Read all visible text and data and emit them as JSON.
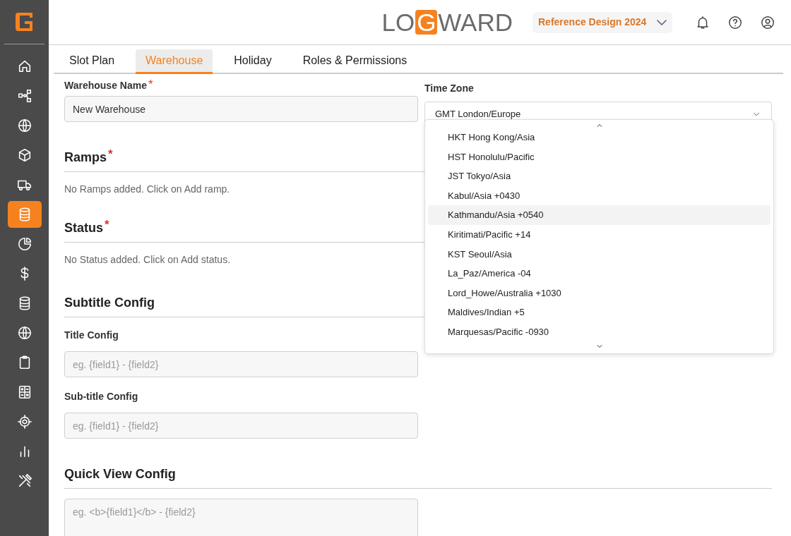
{
  "sidebar": {
    "items": [
      {
        "selected": false
      },
      {
        "selected": false
      },
      {
        "selected": false
      },
      {
        "selected": false
      },
      {
        "selected": false
      },
      {
        "selected": true
      },
      {
        "selected": false
      },
      {
        "selected": false
      },
      {
        "selected": false
      },
      {
        "selected": false
      },
      {
        "selected": false
      },
      {
        "selected": false
      },
      {
        "selected": false
      },
      {
        "selected": false
      },
      {
        "selected": false
      }
    ]
  },
  "header": {
    "logo": {
      "before": "LO",
      "mark": "G",
      "after": "WARD"
    },
    "project": "Reference Design 2024"
  },
  "tabs": [
    {
      "label": "Slot Plan",
      "selected": false
    },
    {
      "label": "Warehouse",
      "selected": true
    },
    {
      "label": "Holiday",
      "selected": false
    },
    {
      "label": "Roles & Permissions",
      "selected": false
    }
  ],
  "form": {
    "warehouse_name": {
      "label": "Warehouse Name",
      "required_mark": "*",
      "value": "New Warehouse"
    },
    "time_zone": {
      "label": "Time Zone",
      "value": "GMT London/Europe",
      "expanded": true,
      "options": [
        {
          "label": "HKT Hong Kong/Asia",
          "highlighted": false
        },
        {
          "label": "HST Honolulu/Pacific",
          "highlighted": false
        },
        {
          "label": "JST Tokyo/Asia",
          "highlighted": false
        },
        {
          "label": "Kabul/Asia +0430",
          "highlighted": false
        },
        {
          "label": "Kathmandu/Asia +0540",
          "highlighted": true
        },
        {
          "label": "Kiritimati/Pacific +14",
          "highlighted": false
        },
        {
          "label": "KST Seoul/Asia",
          "highlighted": false
        },
        {
          "label": "La_Paz/America -04",
          "highlighted": false
        },
        {
          "label": "Lord_Howe/Australia +1030",
          "highlighted": false
        },
        {
          "label": "Maldives/Indian +5",
          "highlighted": false
        },
        {
          "label": "Marquesas/Pacific -0930",
          "highlighted": false
        }
      ]
    },
    "sections": [
      {
        "title": "Ramps",
        "required_mark": "*",
        "empty_text": "No Ramps added. Click on Add ramp."
      },
      {
        "title": "Status",
        "required_mark": "*",
        "empty_text": "No Status added. Click on Add status."
      },
      {
        "title": "Subtitle Config",
        "fields": [
          {
            "label": "Title Config",
            "placeholder": "eg. {field1} - {field2}"
          },
          {
            "label": "Sub-title Config",
            "placeholder": "eg. {field1} - {field2}"
          }
        ]
      },
      {
        "title": "Quick View Config",
        "textarea": {
          "placeholder": "eg. <b>{field1}</b> - {field2}"
        }
      }
    ]
  }
}
